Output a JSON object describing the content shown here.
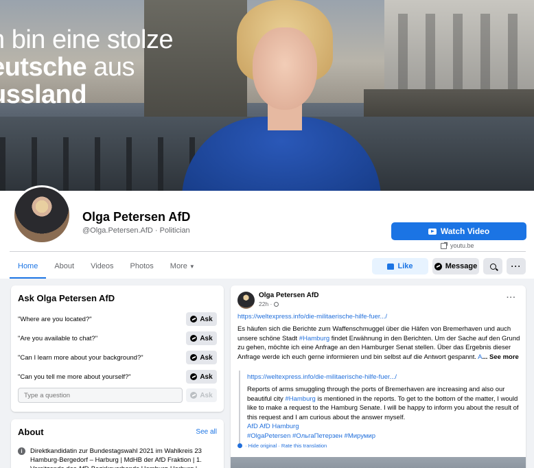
{
  "cover": {
    "slogan_line1": "h bin eine stolze",
    "slogan_line2_bold": "eutsche",
    "slogan_line2_rest": " aus",
    "slogan_line3": "ussland"
  },
  "profile": {
    "name": "Olga Petersen AfD",
    "handle": "@Olga.Petersen.AfD · Politician",
    "watch_label": "Watch Video",
    "watch_domain": "youtu.be"
  },
  "tabs": [
    {
      "label": "Home"
    },
    {
      "label": "About"
    },
    {
      "label": "Videos"
    },
    {
      "label": "Photos"
    },
    {
      "label": "More"
    }
  ],
  "actions": {
    "like": "Like",
    "message": "Message",
    "more": "···"
  },
  "ask": {
    "title": "Ask Olga Petersen AfD",
    "questions": [
      "\"Where are you located?\"",
      "\"Are you available to chat?\"",
      "\"Can I learn more about your background?\"",
      "\"Can you tell me more about yourself?\""
    ],
    "button": "Ask",
    "placeholder": "Type a question"
  },
  "about": {
    "title": "About",
    "see_all": "See all",
    "text": "Direktkandidatin zur Bundestagswahl 2021 im Wahlkreis 23 Hamburg-Bergedorf – Harburg | MdHB der AfD Fraktion | 1. Vorsitzende des AfD-Bezirksverbands Hamburg-Harburg |"
  },
  "post": {
    "author": "Olga Petersen AfD",
    "time": "22h ·",
    "more": "···",
    "link": "https://weltexpress.info/die-militaerische-hilfe-fuer.../",
    "body_1": "Es häufen sich die Berichte zum Waffenschmuggel über die Häfen von Bremerhaven und auch unsere schöne Stadt ",
    "body_tag": "#Hamburg",
    "body_2": " findet Erwähnung in den Berichten. Um der Sache auf den Grund zu gehen, möchte ich eine Anfrage an den Hamburger Senat stellen. Über das Ergebnis dieser Anfrage werde ich euch gerne informieren und bin selbst auf die Antwort gespannt.",
    "body_a": "A",
    "see_more": "... See more",
    "tr_link": "https://weltexpress.info/die-militaerische-hilfe-fuer.../",
    "tr_body_1": "Reports of arms smuggling through the ports of Bremerhaven are increasing and also our beautiful city ",
    "tr_tag": "#Hamburg",
    "tr_body_2": " is mentioned in the reports. To get to the bottom of the matter, I would like to make a request to the Hamburg Senate. I will be happy to inform you about the result of this request and I am curious about the answer myself.",
    "tr_tags_1": "AfD AfD Hamburg",
    "tr_tags_2": "#OlgaPetersen #ОльгаПетерзен #Мирумир",
    "tr_foot": "· Hide original · Rate this translation"
  }
}
